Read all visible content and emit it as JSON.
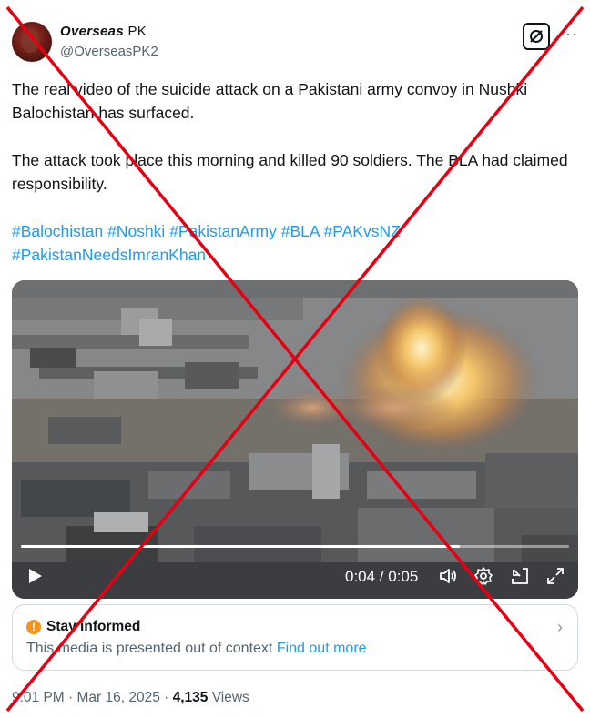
{
  "author": {
    "display_name": "Overseas",
    "display_name_suffix": "PK",
    "handle": "@OverseasPK2"
  },
  "header_icons": {
    "grok": "grok-icon",
    "more": "more-icon",
    "more_glyph": "···"
  },
  "tweet": {
    "paragraphs": [
      "The real video of the suicide attack on a Pakistani army convoy in Nushki Balochistan has surfaced.",
      "The attack took place this morning and killed 90 soldiers. The BLA had claimed responsibility."
    ],
    "hashtags": [
      "#Balochistan",
      "#Noshki",
      "#PakistanArmy",
      "#BLA",
      "#PAKvsNZ",
      "#PakistanNeedsImranKhan"
    ]
  },
  "video": {
    "time_display": "0:04 / 0:05",
    "progress": 0.8,
    "icons": [
      "play-icon",
      "volume-icon",
      "settings-icon",
      "minimize-icon",
      "fullscreen-icon"
    ]
  },
  "context_note": {
    "title": "Stay informed",
    "body": "This media is presented out of context",
    "link": "Find out more"
  },
  "meta": {
    "timestamp": "9:01 PM · Mar 16, 2025 ·",
    "views_count": "4,135",
    "views_label": "Views"
  },
  "colors": {
    "link": "#1d9bf0",
    "cross": "#e60012",
    "secondary_text": "#536471"
  }
}
